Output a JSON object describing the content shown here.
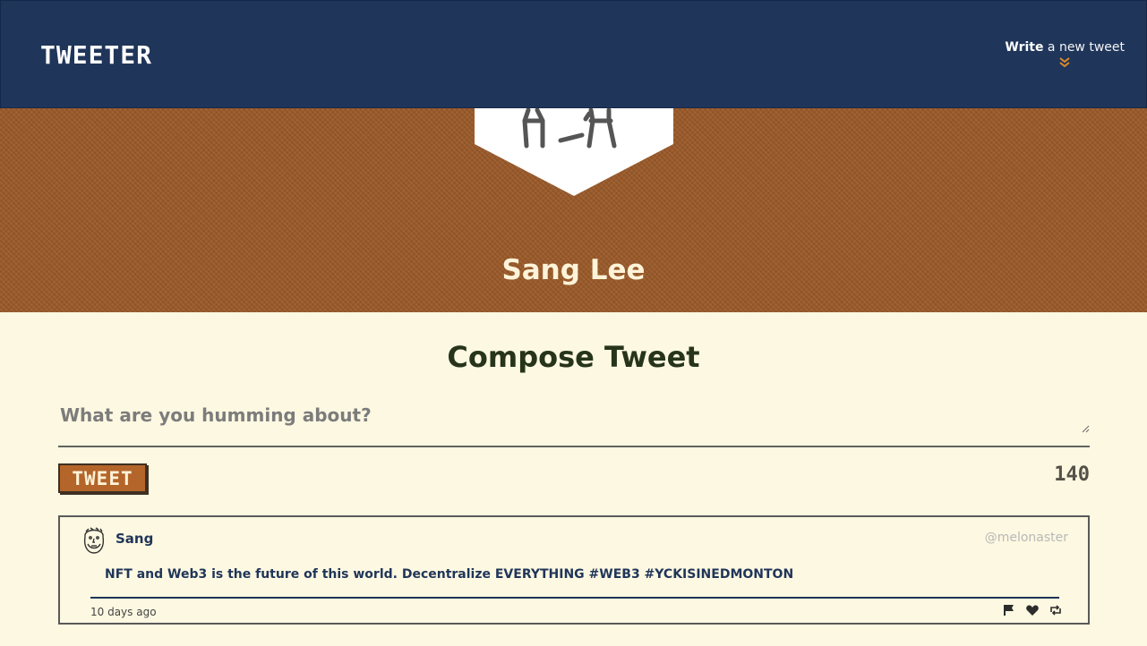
{
  "nav": {
    "brand": "TWEETER",
    "write_bold": "Write",
    "write_rest": " a new tweet",
    "chevron_icon": "double-chevron-down-icon",
    "background": "#1f3559"
  },
  "header": {
    "avatar_icon": "stick-figure-badge-icon",
    "user_name": "Sang Lee",
    "background": "#9c5b2a"
  },
  "compose": {
    "title": "Compose Tweet",
    "placeholder": "What are you humming about?",
    "value": "",
    "button_label": "TWEET",
    "counter": "140",
    "accent": "#b4652a"
  },
  "tweets": [
    {
      "avatar_icon": "bearded-face-avatar-icon",
      "author": "Sang",
      "handle": "@melonaster",
      "content": "NFT and Web3 is the future of this world. Decentralize EVERYTHING #WEB3 #YCKISINEDMONTON",
      "timestamp": "10 days ago",
      "actions": [
        "flag-icon",
        "heart-icon",
        "retweet-icon"
      ]
    }
  ]
}
